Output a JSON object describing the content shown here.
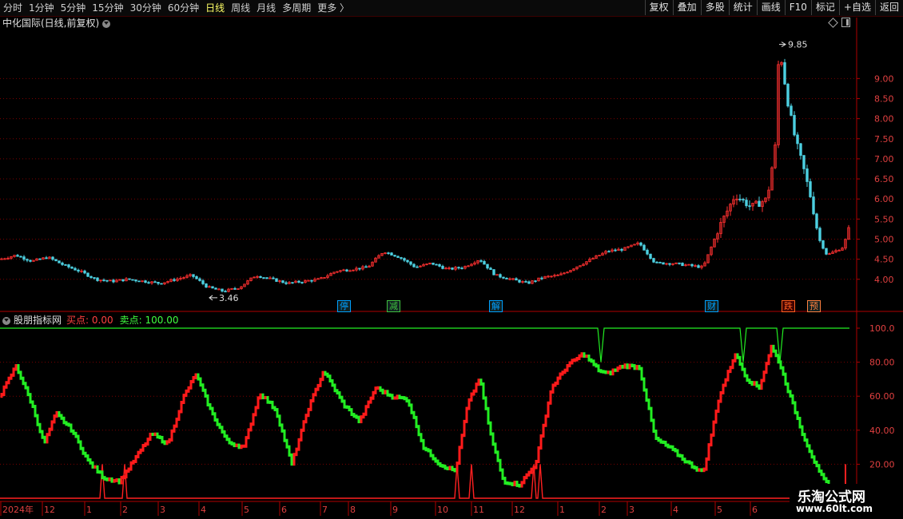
{
  "toolbar": {
    "tabs": [
      "分时",
      "1分钟",
      "5分钟",
      "15分钟",
      "30分钟",
      "60分钟",
      "日线",
      "周线",
      "月线",
      "多周期",
      "更多"
    ],
    "active_index": 6,
    "more_arrow": "〉",
    "right_buttons": [
      "复权",
      "叠加",
      "多股",
      "统计",
      "画线",
      "F10",
      "标记",
      "+自选",
      "返回"
    ]
  },
  "main": {
    "title": "中化国际(日线,前复权)",
    "high_label": "9.85",
    "low_label": "3.46",
    "price_ticks": [
      "9.00",
      "8.50",
      "8.00",
      "7.50",
      "7.00",
      "6.50",
      "6.00",
      "5.50",
      "5.00",
      "4.50",
      "4.00"
    ],
    "events": [
      {
        "text": "停",
        "color": "#00a0ff"
      },
      {
        "text": "减",
        "color": "#40c040"
      },
      {
        "text": "解",
        "color": "#00a0ff"
      },
      {
        "text": "财",
        "color": "#00a0ff"
      },
      {
        "text": "跌",
        "color": "#ff6020"
      },
      {
        "text": "预",
        "color": "#ff8040"
      }
    ]
  },
  "indicator": {
    "name": "股朋指标网",
    "buy_label": "买点:",
    "buy_value": "0.00",
    "sell_label": "卖点:",
    "sell_value": "100.00",
    "ticks": [
      "100.0",
      "80.00",
      "60.00",
      "40.00",
      "20.00"
    ]
  },
  "date_axis": [
    "2024年",
    "12",
    "1",
    "2",
    "3",
    "4",
    "5",
    "6",
    "7",
    "8",
    "9",
    "10",
    "11",
    "12",
    "1",
    "2",
    "3",
    "4",
    "5",
    "6"
  ],
  "watermark": {
    "line1": "乐淘公式网",
    "line2": "www.60lt.com"
  },
  "colors": {
    "up": "#ff3030",
    "down": "#4dd0e1",
    "ind_up": "#ff1a1a",
    "ind_down": "#22ee22",
    "grid": "#7a0000",
    "axis": "#b00000"
  },
  "chart_data": [
    {
      "type": "candlestick-line",
      "title": "中化国际(日线,前复权)",
      "ylim": [
        3.2,
        10.2
      ],
      "series": [
        {
          "x": [
            0,
            20,
            40,
            60,
            80,
            100,
            120,
            140,
            160,
            180,
            200,
            220,
            240,
            260,
            280,
            300,
            320,
            340,
            360,
            380,
            400,
            420,
            440,
            460,
            480,
            500,
            520,
            540,
            560,
            580,
            600,
            620,
            640,
            660,
            680,
            700,
            720,
            740,
            760,
            780,
            800,
            820,
            840,
            860,
            880,
            900,
            920,
            940,
            960,
            970,
            975,
            985,
            995,
            1005,
            1015,
            1025,
            1035,
            1045,
            1055,
            1065
          ],
          "values": [
            4.5,
            4.6,
            4.45,
            4.55,
            4.35,
            4.2,
            4.0,
            3.95,
            4.0,
            3.95,
            3.9,
            4.0,
            4.1,
            3.8,
            3.7,
            3.8,
            4.1,
            4.0,
            3.9,
            3.95,
            4.0,
            4.2,
            4.25,
            4.3,
            4.7,
            4.55,
            4.3,
            4.4,
            4.25,
            4.3,
            4.5,
            4.1,
            4.0,
            3.9,
            4.05,
            4.1,
            4.3,
            4.5,
            4.7,
            4.75,
            4.9,
            4.4,
            4.4,
            4.35,
            4.3,
            5.3,
            6.1,
            5.8,
            6.0,
            7.3,
            9.85,
            8.5,
            7.5,
            6.8,
            6.0,
            5.0,
            4.6,
            4.7,
            4.8,
            5.4
          ]
        }
      ]
    },
    {
      "type": "line",
      "title": "股朋指标网",
      "ylim": [
        0,
        100
      ],
      "series": [
        {
          "x": [
            0,
            20,
            40,
            55,
            70,
            90,
            110,
            130,
            150,
            170,
            190,
            210,
            230,
            245,
            265,
            285,
            305,
            325,
            345,
            365,
            385,
            405,
            430,
            450,
            470,
            490,
            510,
            530,
            550,
            570,
            585,
            600,
            615,
            630,
            650,
            670,
            690,
            710,
            730,
            750,
            760,
            780,
            800,
            820,
            840,
            860,
            880,
            900,
            920,
            935,
            950,
            965,
            975,
            985,
            1005,
            1025,
            1040
          ],
          "values": [
            60,
            78,
            55,
            32,
            50,
            40,
            22,
            12,
            10,
            24,
            38,
            32,
            60,
            73,
            50,
            33,
            30,
            62,
            52,
            20,
            52,
            75,
            55,
            45,
            65,
            60,
            58,
            30,
            20,
            16,
            55,
            71,
            35,
            10,
            8,
            20,
            65,
            78,
            85,
            75,
            73,
            78,
            77,
            35,
            29,
            21,
            15,
            60,
            85,
            70,
            65,
            89,
            80,
            65,
            37,
            15,
            5
          ]
        }
      ]
    }
  ]
}
